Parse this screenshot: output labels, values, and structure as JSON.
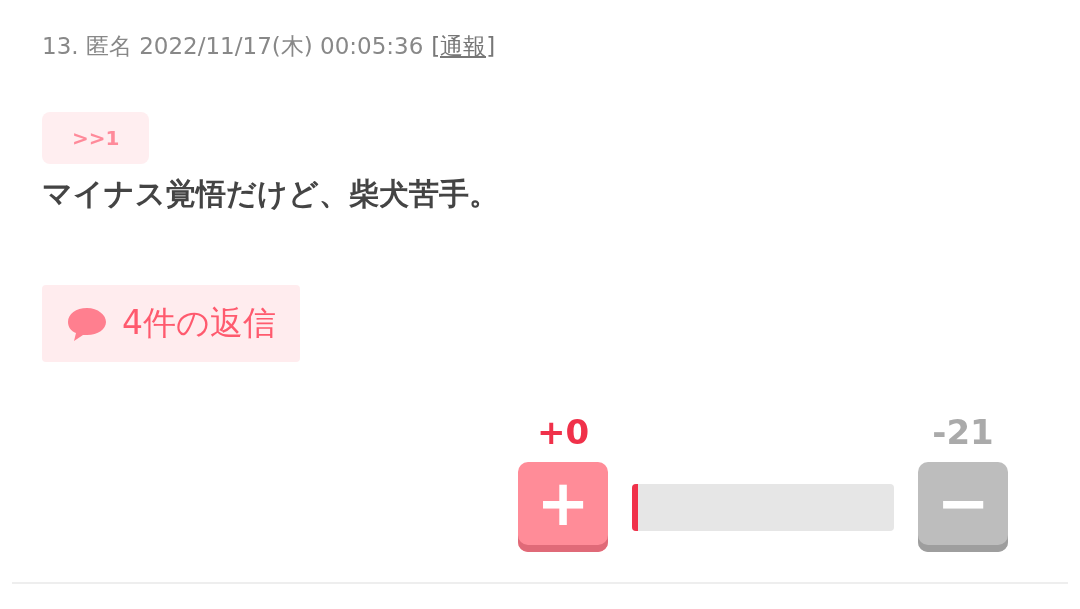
{
  "post": {
    "number": "13.",
    "author": "匿名",
    "date": "2022/11/17(木) 00:05:36",
    "report_link": "[通報]"
  },
  "anchor": ">>1",
  "body": "マイナス覚悟だけど、柴犬苦手。",
  "replies": {
    "label": "4件の返信"
  },
  "votes": {
    "plus_count": "+0",
    "minus_count": "-21",
    "plus_label": "+",
    "minus_label": "−",
    "level": 0
  }
}
